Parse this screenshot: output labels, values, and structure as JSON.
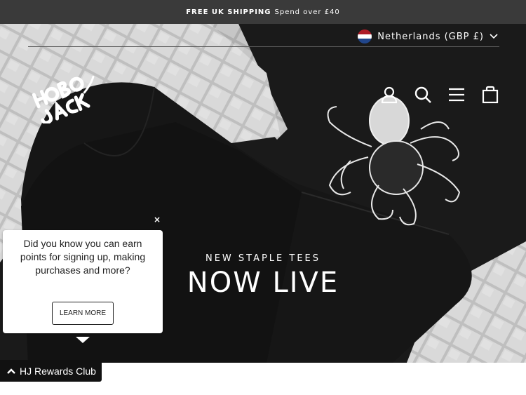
{
  "announcement": {
    "strong": "FREE UK SHIPPING",
    "light": "Spend over £40"
  },
  "header": {
    "locale": "Netherlands (GBP £)",
    "logo_text": "HOBO JACK",
    "icons": [
      "account-icon",
      "search-icon",
      "menu-icon",
      "cart-icon"
    ]
  },
  "hero": {
    "kicker": "NEW STAPLE TEES",
    "headline": "NOW LIVE"
  },
  "popup": {
    "message": "Did you know you can earn points for signing up, making purchases and more?",
    "button": "LEARN MORE",
    "close": "×"
  },
  "rewards": {
    "label": "HJ Rewards Club"
  },
  "colors": {
    "announce_bg": "#3a3a3a",
    "hero_bg": "#1b1b1b",
    "flag": [
      "#ae1c28",
      "#ffffff",
      "#21468b"
    ]
  }
}
